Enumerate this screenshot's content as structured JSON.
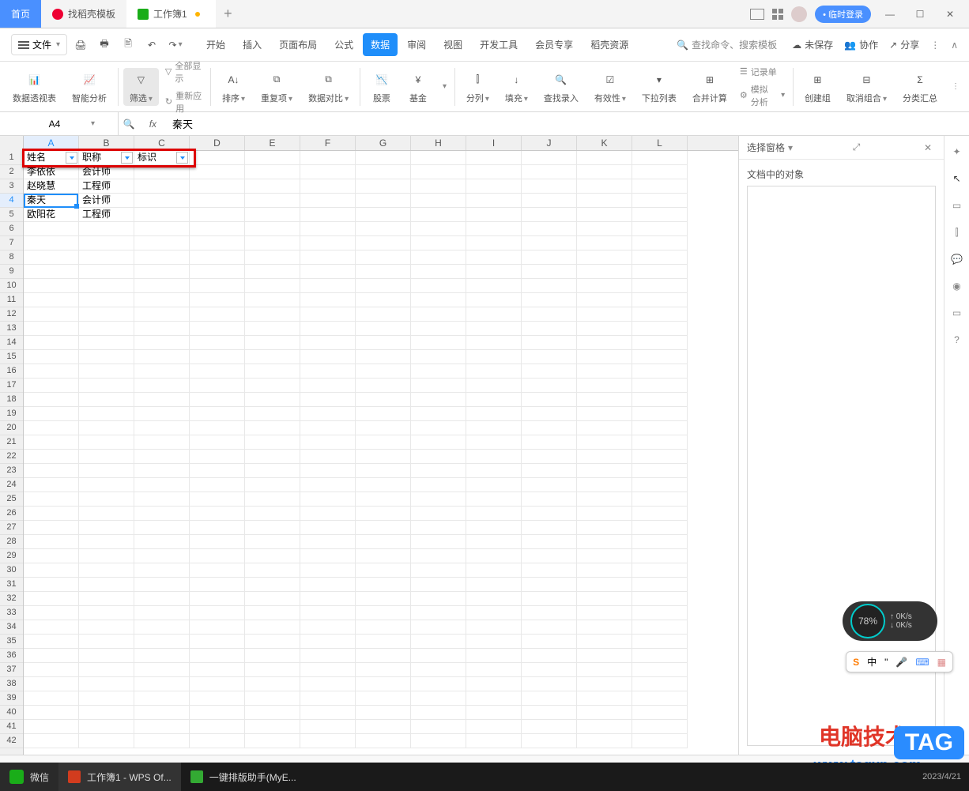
{
  "titlebar": {
    "home": "首页",
    "template": "找稻壳模板",
    "workbook": "工作簿1",
    "login": "临时登录"
  },
  "menubar": {
    "file": "文件",
    "tabs": [
      "开始",
      "插入",
      "页面布局",
      "公式",
      "数据",
      "审阅",
      "视图",
      "开发工具",
      "会员专享",
      "稻壳资源"
    ],
    "active_index": 4,
    "search_placeholder": "查找命令、搜索模板",
    "unsaved": "未保存",
    "coop": "协作",
    "share": "分享"
  },
  "ribbon": {
    "pivot": "数据透视表",
    "smart": "智能分析",
    "filter": "筛选",
    "show_all": "全部显示",
    "reapply": "重新应用",
    "sort": "排序",
    "dup": "重复项",
    "compare": "数据对比",
    "stock": "股票",
    "fund": "基金",
    "split": "分列",
    "fill": "填充",
    "lookup": "查找录入",
    "valid": "有效性",
    "dropdown": "下拉列表",
    "consol": "合并计算",
    "record": "记录单",
    "sim": "模拟分析",
    "group": "创建组",
    "ungroup": "取消组合",
    "subtotal": "分类汇总"
  },
  "namebox": {
    "ref": "A4"
  },
  "formula": {
    "value": "秦天"
  },
  "columns": [
    "A",
    "B",
    "C",
    "D",
    "E",
    "F",
    "G",
    "H",
    "I",
    "J",
    "K",
    "L"
  ],
  "row_count": 42,
  "selected_col": 0,
  "selected_row": 4,
  "table": {
    "headers": [
      "姓名",
      "职称",
      "标识"
    ],
    "rows": [
      [
        "李依依",
        "会计师",
        ""
      ],
      [
        "赵晓慧",
        "工程师",
        ""
      ],
      [
        "秦天",
        "会计师",
        ""
      ],
      [
        "欧阳花",
        "工程师",
        ""
      ]
    ]
  },
  "sidepanel": {
    "title": "选择窗格",
    "objects_label": "文档中的对象"
  },
  "taskbar": {
    "wechat": "微信",
    "wps": "工作簿1 - WPS Of...",
    "helper": "一键排版助手(MyE...",
    "date": "2023/4/21"
  },
  "watermark": {
    "text": "电脑技术网",
    "url": "www.tagxp.com",
    "tag": "TAG"
  },
  "network": {
    "pct": "78%",
    "up": "0K/s",
    "down": "0K/s"
  },
  "ime": {
    "lang": "中"
  }
}
